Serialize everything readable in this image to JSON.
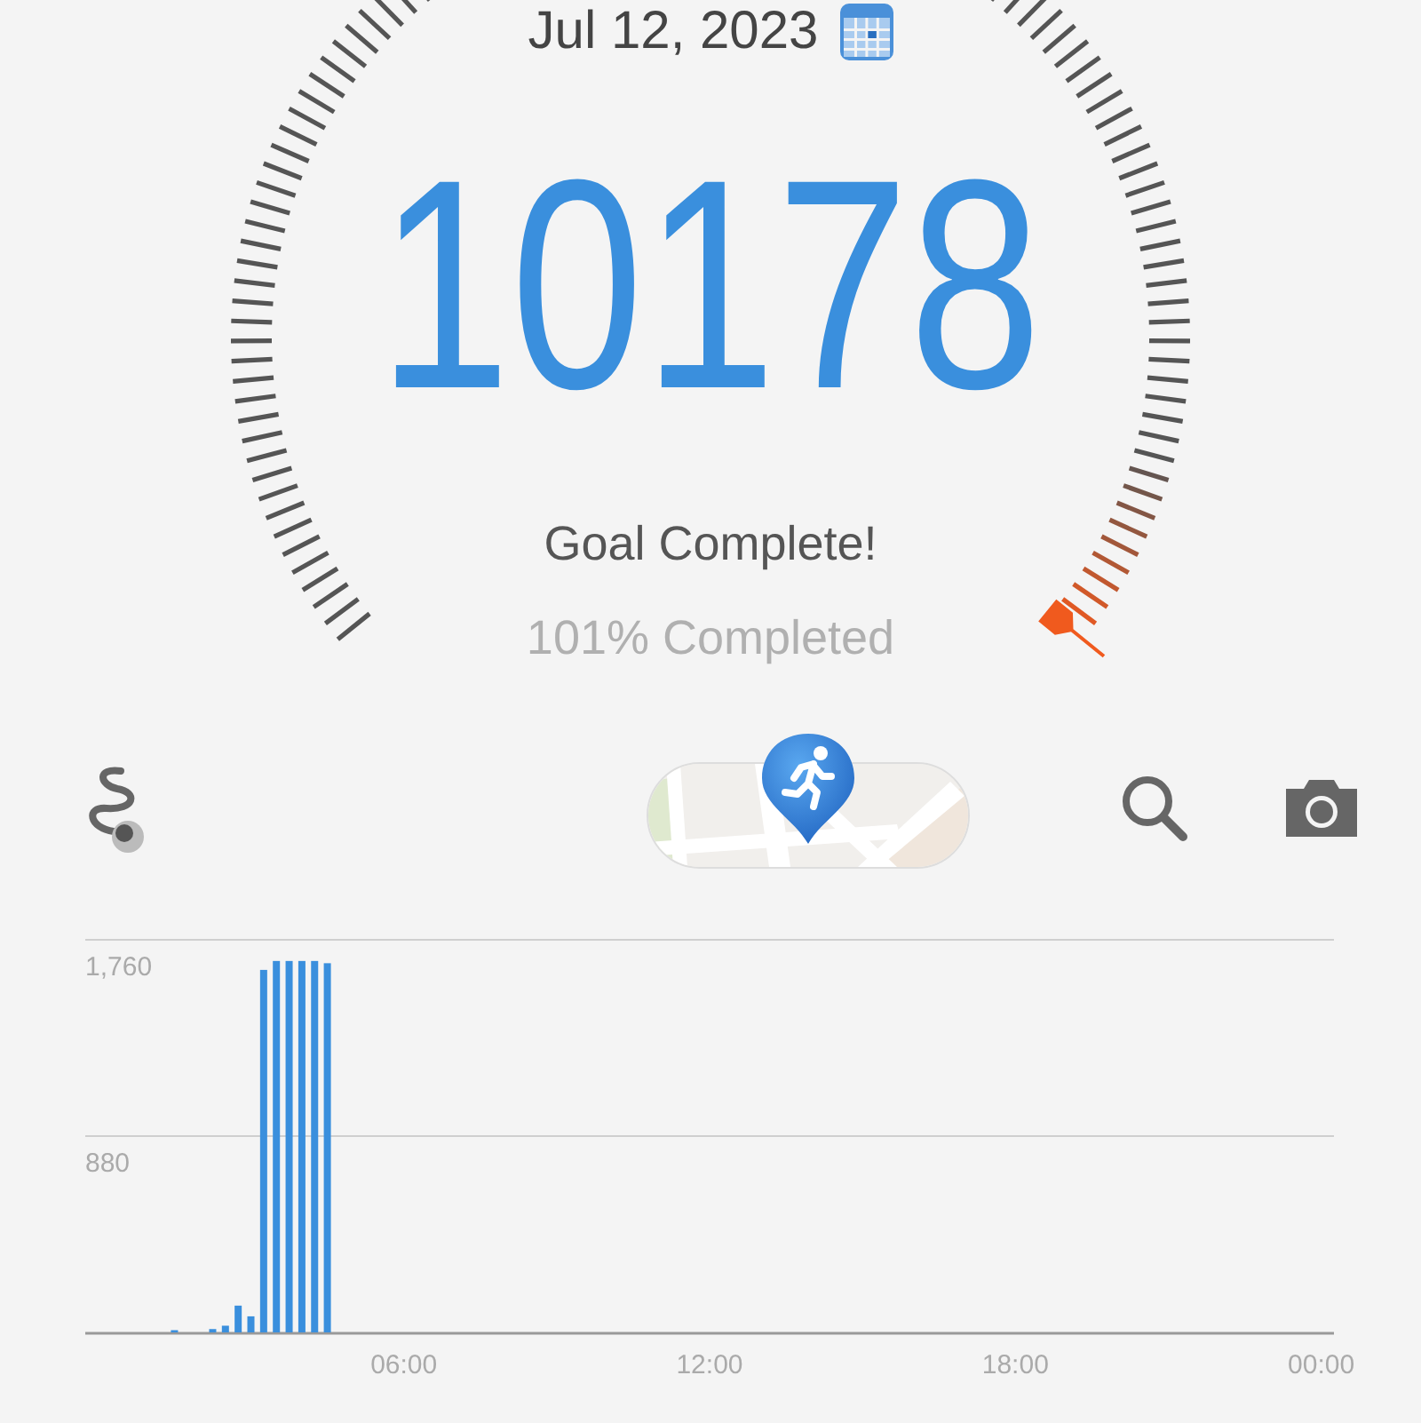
{
  "header": {
    "date": "Jul 12, 2023"
  },
  "steps": "10178",
  "status": "Goal Complete!",
  "progress": "101% Completed",
  "chart": {
    "chart_data": {
      "type": "bar",
      "x": [
        1.5,
        2.25,
        2.5,
        2.75,
        3.0,
        3.25,
        3.5,
        3.75,
        4.0,
        4.25,
        4.5
      ],
      "series": [
        {
          "color": "#3a8fdd",
          "values": [
            10,
            15,
            30,
            120,
            72,
            1625,
            1665,
            1665,
            1665,
            1665,
            1655
          ]
        }
      ],
      "xlim": [
        -0.25,
        24.25
      ],
      "ylim": [
        0,
        1760
      ],
      "xticks": [
        {
          "value": 6,
          "label": "06:00"
        },
        {
          "value": 12,
          "label": "12:00"
        },
        {
          "value": 18,
          "label": "18:00"
        },
        {
          "value": 24,
          "label": "00:00"
        }
      ],
      "yticks": [
        {
          "value": 880,
          "label": "880"
        },
        {
          "value": 1760,
          "label": "1,760"
        }
      ]
    }
  }
}
